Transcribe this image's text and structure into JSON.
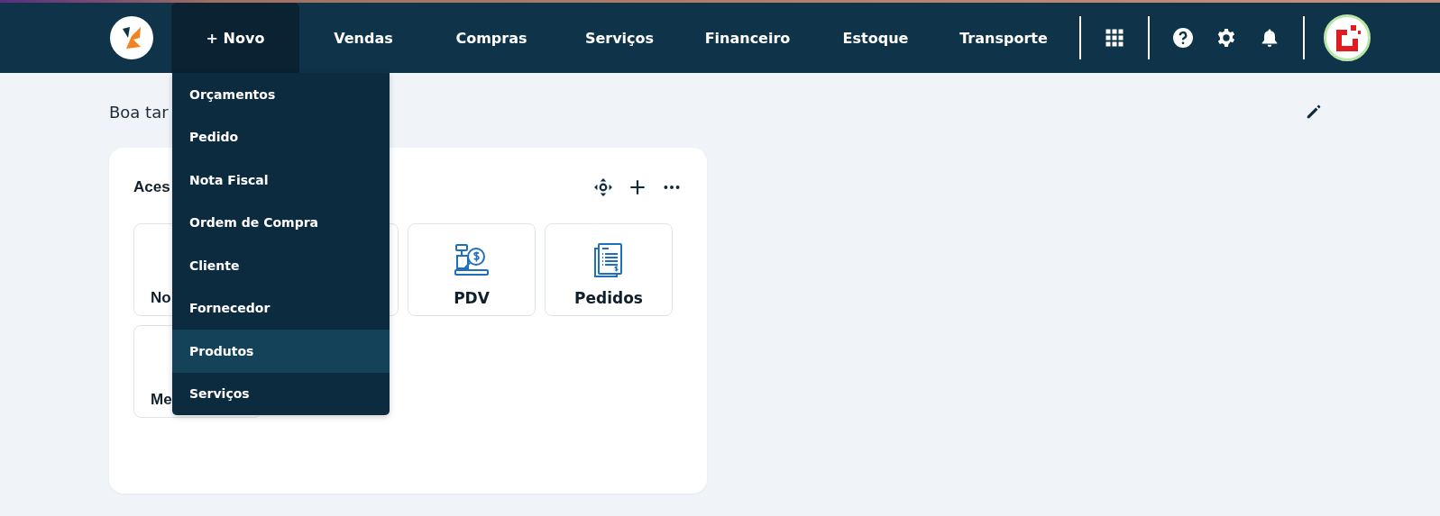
{
  "nav": {
    "items": [
      {
        "label": "+ Novo",
        "selected": true
      },
      {
        "label": "Vendas",
        "selected": false
      },
      {
        "label": "Compras",
        "selected": false
      },
      {
        "label": "Serviços",
        "selected": false
      },
      {
        "label": "Financeiro",
        "selected": false
      },
      {
        "label": "Estoque",
        "selected": false
      },
      {
        "label": "Transporte",
        "selected": false
      }
    ]
  },
  "dropdown": {
    "items": [
      {
        "label": "Orçamentos",
        "highlighted": false
      },
      {
        "label": "Pedido",
        "highlighted": false
      },
      {
        "label": "Nota Fiscal",
        "highlighted": false
      },
      {
        "label": "Ordem de Compra",
        "highlighted": false
      },
      {
        "label": "Cliente",
        "highlighted": false
      },
      {
        "label": "Fornecedor",
        "highlighted": false
      },
      {
        "label": "Produtos",
        "highlighted": true
      },
      {
        "label": "Serviços",
        "highlighted": false
      }
    ]
  },
  "greeting": "Boa tar",
  "card": {
    "title": "Aces",
    "tiles": [
      {
        "kind": "partial",
        "label": "No"
      },
      {
        "kind": "blank"
      },
      {
        "kind": "register",
        "label": "PDV"
      },
      {
        "kind": "document",
        "label": "Pedidos"
      },
      {
        "kind": "partial",
        "label": "Me"
      }
    ]
  }
}
